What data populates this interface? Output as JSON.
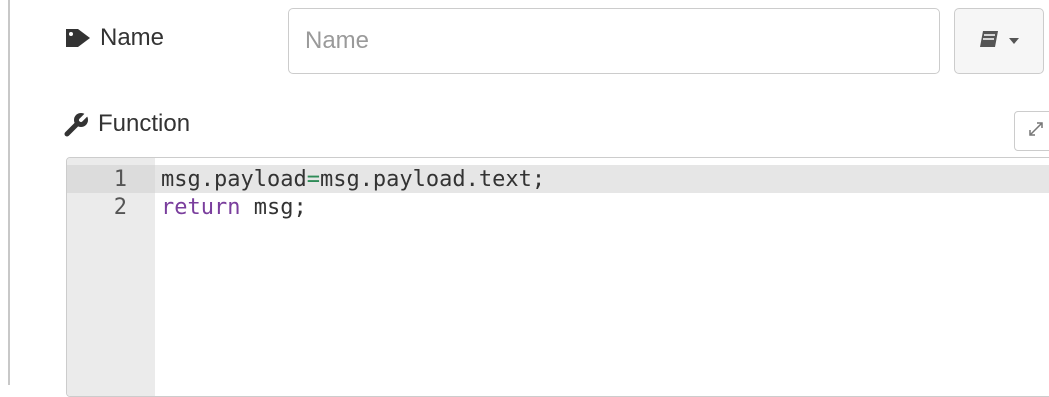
{
  "name_field": {
    "label": "Name",
    "placeholder": "Name",
    "value": "",
    "label_icon": "tag-icon"
  },
  "library_button": {
    "icon": "book-icon",
    "dropdown_icon": "caret-down-icon"
  },
  "function_section": {
    "label": "Function",
    "label_icon": "wrench-icon",
    "expand_icon": "expand-icon"
  },
  "editor": {
    "lines": [
      {
        "number": "1",
        "tokens": [
          {
            "text": "msg.payload",
            "type": "plain"
          },
          {
            "text": "=",
            "type": "operator"
          },
          {
            "text": "msg.payload.text;",
            "type": "plain"
          }
        ]
      },
      {
        "number": "2",
        "tokens": [
          {
            "text": "return",
            "type": "keyword"
          },
          {
            "text": " msg;",
            "type": "plain"
          }
        ]
      }
    ]
  },
  "colors": {
    "keyword": "#7a3e9d",
    "operator": "#2e8b57",
    "gutter": "#ebebeb",
    "active_line": "#e6e6e6"
  }
}
